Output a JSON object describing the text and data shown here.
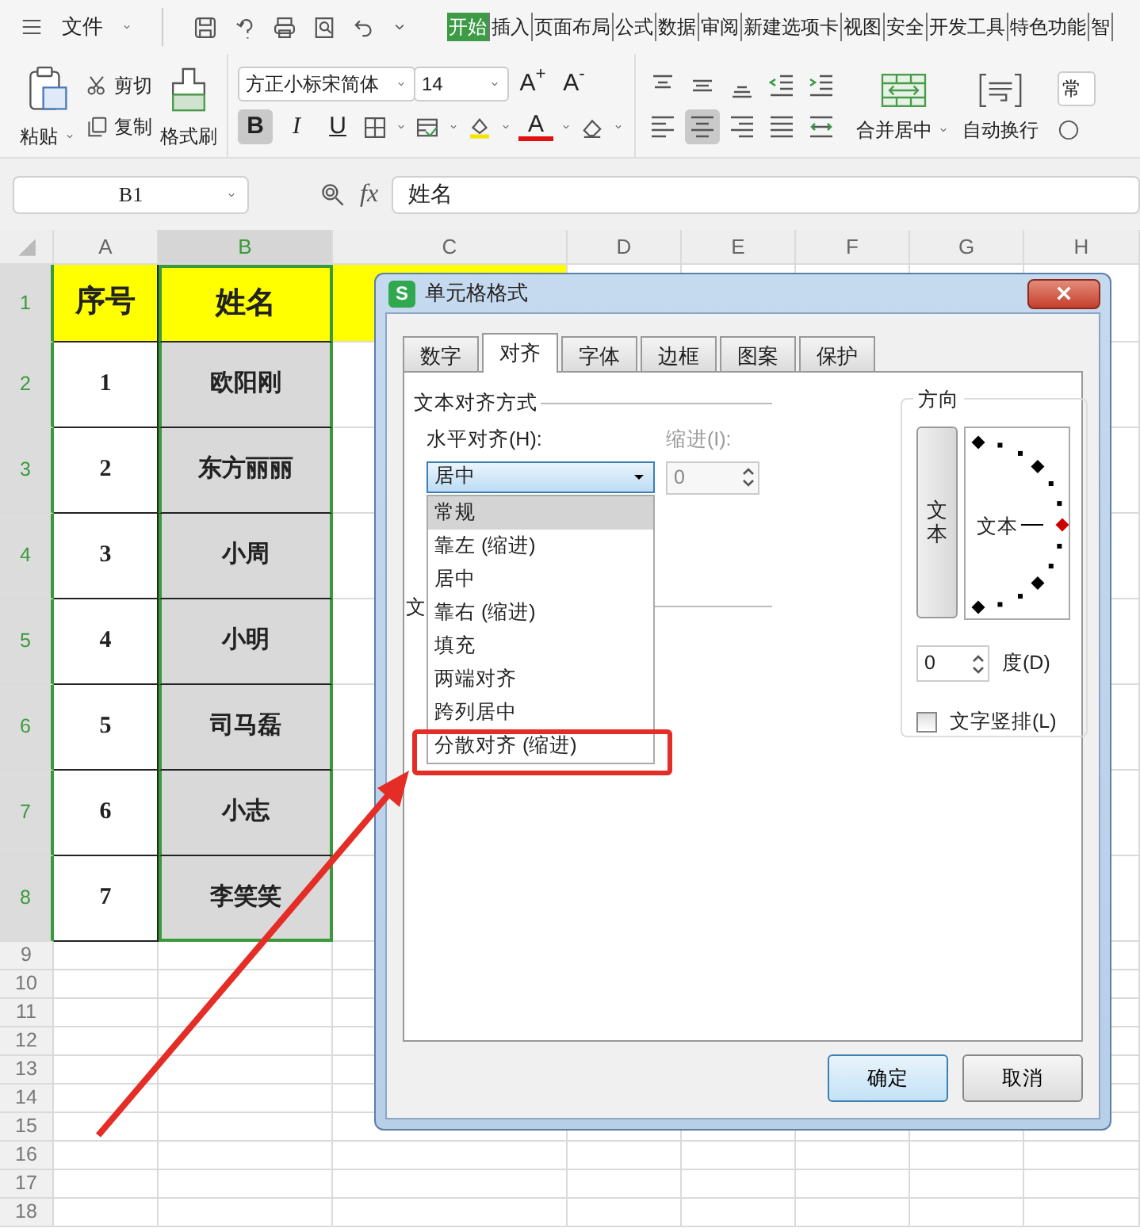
{
  "menu": {
    "file_label": "文件",
    "tabs": [
      {
        "label": "开始",
        "selected": true
      },
      {
        "label": "插入",
        "selected": false
      },
      {
        "label": "页面布局",
        "selected": false
      },
      {
        "label": "公式",
        "selected": false
      },
      {
        "label": "数据",
        "selected": false
      },
      {
        "label": "审阅",
        "selected": false
      },
      {
        "label": "新建选项卡",
        "selected": false
      },
      {
        "label": "视图",
        "selected": false
      },
      {
        "label": "安全",
        "selected": false
      },
      {
        "label": "开发工具",
        "selected": false
      },
      {
        "label": "特色功能",
        "selected": false
      },
      {
        "label": "智",
        "selected": false
      }
    ]
  },
  "ribbon": {
    "paste": "粘贴",
    "cut": "剪切",
    "copy": "复制",
    "format_painter": "格式刷",
    "font_name": "方正小标宋简体",
    "font_size": "14",
    "grow_font": "A$^{+}$",
    "shrink_font": "A$^{-}$",
    "format_buttons": [
      {
        "kind": "bold",
        "label": "B",
        "selected": true
      },
      {
        "kind": "italic",
        "label": "I",
        "selected": false
      },
      {
        "kind": "underline",
        "label": "U",
        "selected": false
      }
    ],
    "font_color_label": "A",
    "align_buttons": [
      {
        "kind": "top",
        "selected": false
      },
      {
        "kind": "middle",
        "selected": false
      },
      {
        "kind": "bottom",
        "selected": false
      },
      {
        "kind": "outdent",
        "selected": false
      },
      {
        "kind": "indent",
        "selected": false
      },
      {
        "kind": "left",
        "selected": false
      },
      {
        "kind": "center",
        "selected": true
      },
      {
        "kind": "right",
        "selected": false
      },
      {
        "kind": "justify",
        "selected": false
      },
      {
        "kind": "distributed",
        "selected": false
      }
    ],
    "merge_center": "合并居中",
    "wrap_text": "自动换行",
    "number_format": "常"
  },
  "formula_bar": {
    "cell_ref": "B1",
    "fx": "fx",
    "formula": "姓名"
  },
  "sheet": {
    "columns": [
      {
        "label": "A",
        "selected": false
      },
      {
        "label": "B",
        "selected": true
      },
      {
        "label": "C",
        "selected": false
      },
      {
        "label": "D",
        "selected": false
      },
      {
        "label": "E",
        "selected": false
      },
      {
        "label": "F",
        "selected": false
      },
      {
        "label": "G",
        "selected": false
      },
      {
        "label": "H",
        "selected": false
      }
    ],
    "rows": [
      {
        "label": "1",
        "selected": true,
        "kind": "header",
        "cells": [
          "序号",
          "姓名"
        ]
      },
      {
        "label": "2",
        "selected": true,
        "kind": "data",
        "cells": [
          "1",
          "欧阳刚"
        ]
      },
      {
        "label": "3",
        "selected": true,
        "kind": "data",
        "cells": [
          "2",
          "东方丽丽"
        ]
      },
      {
        "label": "4",
        "selected": true,
        "kind": "data",
        "cells": [
          "3",
          "小周"
        ]
      },
      {
        "label": "5",
        "selected": true,
        "kind": "data",
        "cells": [
          "4",
          "小明"
        ]
      },
      {
        "label": "6",
        "selected": true,
        "kind": "data",
        "cells": [
          "5",
          "司马磊"
        ]
      },
      {
        "label": "7",
        "selected": true,
        "kind": "data",
        "cells": [
          "6",
          "小志"
        ]
      },
      {
        "label": "8",
        "selected": true,
        "kind": "data",
        "cells": [
          "7",
          "李笑笑"
        ]
      },
      {
        "label": "9",
        "selected": false
      },
      {
        "label": "10",
        "selected": false
      },
      {
        "label": "11",
        "selected": false
      },
      {
        "label": "12",
        "selected": false
      },
      {
        "label": "13",
        "selected": false
      },
      {
        "label": "14",
        "selected": false
      },
      {
        "label": "15",
        "selected": false
      },
      {
        "label": "16",
        "selected": false
      },
      {
        "label": "17",
        "selected": false
      },
      {
        "label": "18",
        "selected": false
      }
    ]
  },
  "dialog": {
    "logo": "S",
    "title": "单元格格式",
    "tabs": [
      {
        "label": "数字",
        "selected": false
      },
      {
        "label": "对齐",
        "selected": true
      },
      {
        "label": "字体",
        "selected": false
      },
      {
        "label": "边框",
        "selected": false
      },
      {
        "label": "图案",
        "selected": false
      },
      {
        "label": "保护",
        "selected": false
      }
    ],
    "align_group": "文本对齐方式",
    "horizontal_label": "水平对齐(H):",
    "horizontal_value": "居中",
    "expanded": true,
    "horizontal_options": [
      {
        "label": "常规",
        "selected": true
      },
      {
        "label": "靠左 (缩进)",
        "selected": false
      },
      {
        "label": "居中",
        "selected": false
      },
      {
        "label": "靠右 (缩进)",
        "selected": false
      },
      {
        "label": "填充",
        "selected": false
      },
      {
        "label": "两端对齐",
        "selected": false
      },
      {
        "label": "跨列居中",
        "selected": false
      },
      {
        "label": "分散对齐 (缩进)",
        "selected": false
      }
    ],
    "indent_label": "缩进(I):",
    "indent_value": "0",
    "indent_disabled": true,
    "second_group": "文",
    "direction_group": "方向",
    "vertical_text": "文本",
    "dial_text": "文本",
    "degree_value": "0",
    "degree_label": "度(D)",
    "vertical_checkbox": {
      "label": "文字竖排(L)",
      "checked": false
    },
    "buttons": [
      {
        "label": "确定",
        "kind": "default"
      },
      {
        "label": "取消",
        "kind": "normal"
      }
    ]
  }
}
